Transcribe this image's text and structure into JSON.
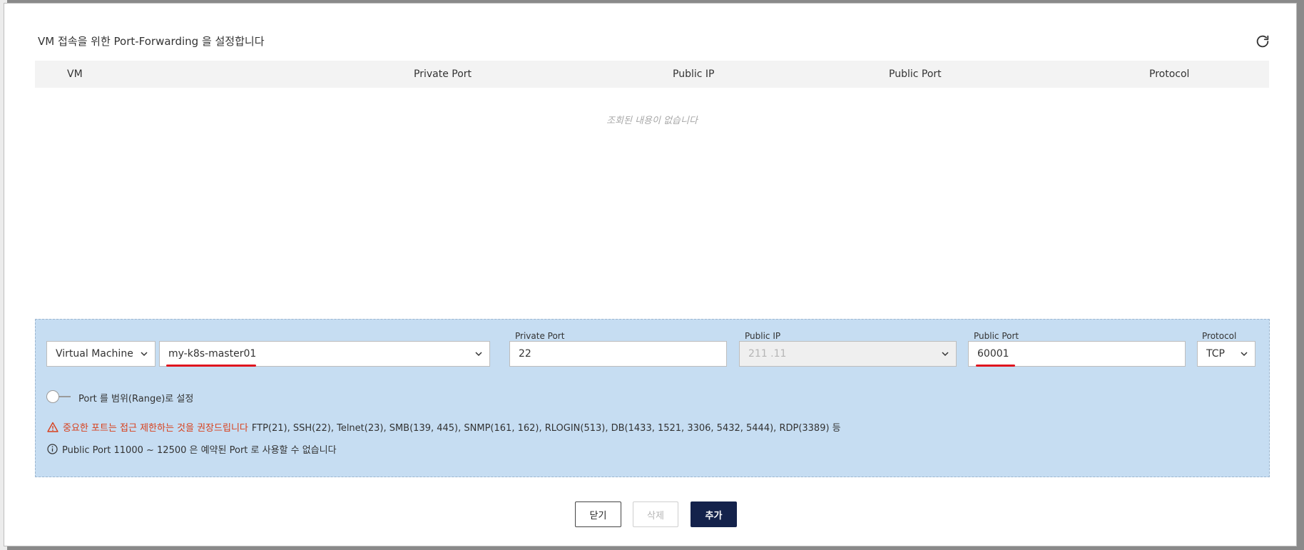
{
  "dialog": {
    "title": "VM 접속을 위한 Port-Forwarding 을 설정합니다",
    "refresh_icon": "refresh-icon"
  },
  "table": {
    "columns": [
      "VM",
      "Private Port",
      "Public IP",
      "Public Port",
      "Protocol"
    ],
    "rows": [],
    "empty_text": "조회된 내용이 없습니다"
  },
  "form": {
    "target_type": {
      "value": "Virtual Machine"
    },
    "vm_select": {
      "value": "my-k8s-master01"
    },
    "private_port": {
      "label": "Private Port",
      "value": "22"
    },
    "public_ip": {
      "label": "Public IP",
      "value": "211 .11"
    },
    "public_port": {
      "label": "Public Port",
      "value": "60001"
    },
    "protocol": {
      "label": "Protocol",
      "value": "TCP"
    },
    "range_toggle": {
      "label": "Port 를 범위(Range)로 설정",
      "on": false
    },
    "warning": {
      "text": "중요한 포트는 접근 제한하는 것을 권장드립니다",
      "ports": "FTP(21), SSH(22), Telnet(23), SMB(139, 445), SNMP(161, 162), RLOGIN(513), DB(1433, 1521, 3306, 5432, 5444), RDP(3389) 등"
    },
    "info": {
      "text": "Public Port 11000 ~ 12500 은 예약된 Port 로 사용할 수 없습니다"
    }
  },
  "buttons": {
    "close": "닫기",
    "delete": "삭제",
    "add": "추가"
  },
  "colors": {
    "form_bg": "#c6ddf2",
    "primary": "#14224b",
    "warning": "#d8401c",
    "annotation": "#e0141e"
  }
}
